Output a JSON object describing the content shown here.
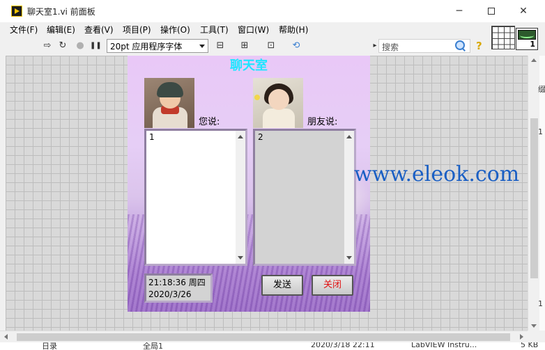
{
  "window": {
    "title": "聊天室1.vi 前面板",
    "minimize_glyph": "─",
    "close_glyph": "✕"
  },
  "menu": [
    {
      "label": "文件(F)"
    },
    {
      "label": "编辑(E)"
    },
    {
      "label": "查看(V)"
    },
    {
      "label": "项目(P)"
    },
    {
      "label": "操作(O)"
    },
    {
      "label": "工具(T)"
    },
    {
      "label": "窗口(W)"
    },
    {
      "label": "帮助(H)"
    }
  ],
  "toolbar": {
    "font_select": "20pt 应用程序字体",
    "search_placeholder": "搜索",
    "help_glyph": "?",
    "run_glyph": "⇨",
    "run_continuous_glyph": "↻",
    "abort_glyph": "●",
    "pause_glyph": "❚❚",
    "align_glyph": "⊟",
    "distribute_glyph": "⊞",
    "resize_glyph": "⊡",
    "reorder_glyph": "⟲",
    "expand_glyph": "▸"
  },
  "vi_icon": {
    "number": "1"
  },
  "panel": {
    "title": "聊天室",
    "my_label": "您说:",
    "friend_label": "朋友说:",
    "my_text": "1",
    "friend_text": "2",
    "time": "21:18:36  周四",
    "date": "2020/3/26",
    "send_button": "发送",
    "close_button": "关闭"
  },
  "watermark": "www.eleok.com",
  "edge": {
    "glyph_top": "缀",
    "glyph_mid": "1",
    "glyph_low": "1"
  },
  "taskbar": {
    "item_left": "日录",
    "item_mid": "全局1",
    "item_date": "2020/3/18 22:11",
    "item_app": "LabVIEW Instru...",
    "item_size": "5 KB"
  },
  "colors": {
    "title_cyan": "#1ee6ff",
    "close_red": "#e01010",
    "watermark_blue": "#1a5fc4",
    "panel_lavender": "#e6cef6"
  }
}
